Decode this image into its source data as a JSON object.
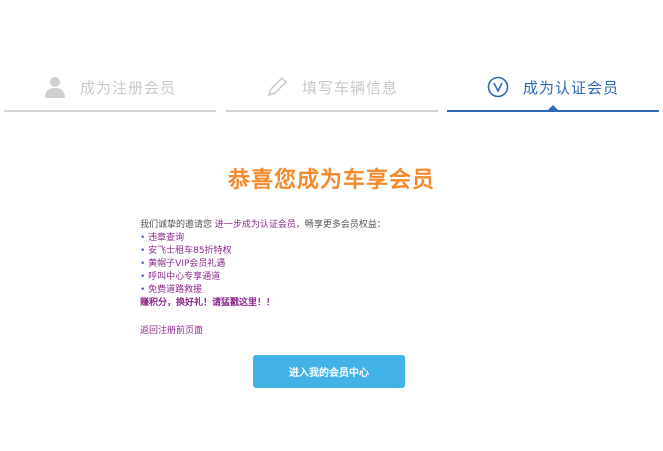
{
  "steps": [
    {
      "label": "成为注册会员",
      "icon": "user-icon",
      "state": "done"
    },
    {
      "label": "填写车辆信息",
      "icon": "pencil-icon",
      "state": "done"
    },
    {
      "label": "成为认证会员",
      "icon": "v-badge-icon",
      "state": "active"
    }
  ],
  "title": "恭喜您成为车享会员",
  "intro": {
    "prefix": "我们诚挚的邀请您 ",
    "highlight": "进一步成为认证会员",
    "suffix": "，畅享更多会员权益："
  },
  "benefits": [
    "违章查询",
    "安飞士租车85折特权",
    "黄帽子VIP会员礼遇",
    "呼叫中心专享通道",
    "免费道路救援"
  ],
  "promo": "赚积分，换好礼！请猛戳这里！！",
  "back_link": "返回注册前页面",
  "cta_button": "进入我的会员中心",
  "colors": {
    "accent_blue": "#2f69b3",
    "title_orange": "#f28a2e",
    "button_blue": "#43b2e6",
    "link_purple": "#8b2a8b",
    "inactive_gray": "#c8c8c8"
  }
}
